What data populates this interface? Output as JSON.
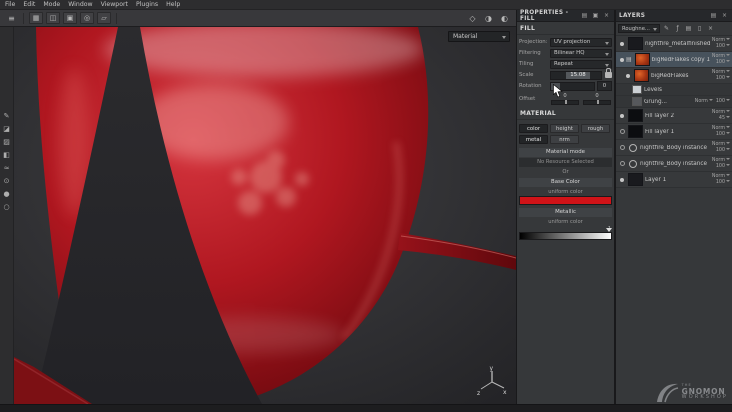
{
  "menubar": {
    "items": [
      "File",
      "Edit",
      "Mode",
      "Window",
      "Viewport",
      "Plugins",
      "Help"
    ]
  },
  "icons": {
    "hamburger": "≡",
    "grid": "▦",
    "mirror": "◫",
    "snap": "▣",
    "focus": "◎",
    "perspective": "▱",
    "camera": "◇",
    "shading": "◑",
    "render": "◐",
    "paint": "✎",
    "erase": "◪",
    "projection": "▨",
    "polygon_fill": "◧",
    "smudge": "≈",
    "clone": "⊙",
    "material_pick": "●",
    "mask_tool": "○",
    "panel_menu": "▤",
    "dock": "▣",
    "close": "×",
    "fx": "ƒ",
    "brush": "✎",
    "stack": "▤",
    "square": "▯"
  },
  "viewport": {
    "shading_mode": "Material",
    "axis_x": "x",
    "axis_y": "y",
    "axis_z": "z"
  },
  "properties": {
    "title": "PROPERTIES - FILL",
    "fill_section": "FILL",
    "projection_label": "Projection:",
    "projection_value": "UV projection",
    "filtering_label": "Filtering",
    "filtering_value": "Bilinear HQ",
    "tiling_label": "Tiling",
    "tiling_value": "Repeat",
    "scale_label": "Scale",
    "scale_value": "15.08",
    "rotation_label": "Rotation",
    "rotation_value": "0",
    "offset_label": "Offset",
    "offset_u": "0",
    "offset_v": "0",
    "material_section": "MATERIAL",
    "channels": [
      "color",
      "height",
      "rough",
      "metal",
      "nrm"
    ],
    "material_mode_label": "Material mode",
    "material_mode_value": "No Resource Selected",
    "or_label": "Or",
    "base_color_label": "Base Color",
    "base_color_mode": "uniform color",
    "base_color": "#d01318",
    "metallic_label": "Metallic",
    "metallic_mode": "uniform color",
    "metallic_value": "1"
  },
  "layers": {
    "title": "LAYERS",
    "channel_filter": "Roughne...",
    "items": [
      {
        "name": "nightfire_metalfinished",
        "blend": "Norm",
        "opacity": "100"
      },
      {
        "name": "bigRedFlakes copy 1",
        "blend": "Norm",
        "opacity": "100"
      },
      {
        "name": "bigRedFlakes",
        "blend": "Norm",
        "opacity": "100"
      },
      {
        "name": "Levels",
        "blend": "",
        "opacity": ""
      },
      {
        "name": "Grung...",
        "blend": "Norm",
        "opacity": "100"
      },
      {
        "name": "Fill layer 2",
        "blend": "Norm",
        "opacity": "45"
      },
      {
        "name": "Fill layer 1",
        "blend": "Norm",
        "opacity": "100"
      },
      {
        "name": "nightfire_Body instance",
        "blend": "Norm",
        "opacity": "100"
      },
      {
        "name": "nightfire_Body instance",
        "blend": "Norm",
        "opacity": "100"
      },
      {
        "name": "Layer 1",
        "blend": "Norm",
        "opacity": "100"
      }
    ]
  },
  "watermark": {
    "the": "THE",
    "line1": "GNOMON",
    "line2": "WORKSHOP"
  }
}
